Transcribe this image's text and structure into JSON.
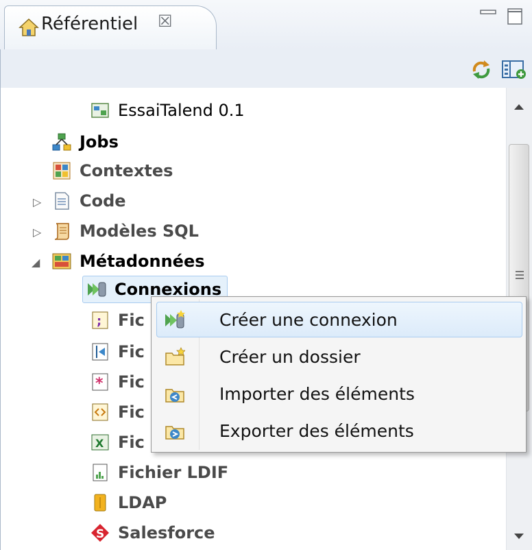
{
  "view": {
    "tab_title": "Référentiel",
    "close_symbol": "☒"
  },
  "tree": {
    "items": [
      {
        "label": "EssaiTalend 0.1",
        "icon": "project-icon",
        "color": "#1a1a1a"
      },
      {
        "label": "Jobs",
        "icon": "jobs-icon",
        "color": "#000000"
      },
      {
        "label": "Contextes",
        "icon": "contexts-icon",
        "color": "#4a4a4a"
      },
      {
        "label": "Code",
        "icon": "code-icon",
        "color": "#4a4a4a"
      },
      {
        "label": "Modèles SQL",
        "icon": "sql-templates-icon",
        "color": "#4a4a4a"
      },
      {
        "label": "Métadonnées",
        "icon": "metadata-icon",
        "color": "#000000"
      },
      {
        "label": "Connexions",
        "icon": "connections-icon",
        "color": "#000000"
      },
      {
        "label": "Fic",
        "icon": "delimited-file-icon",
        "color": "#4a4a4a"
      },
      {
        "label": "Fic",
        "icon": "positional-file-icon",
        "color": "#4a4a4a"
      },
      {
        "label": "Fic",
        "icon": "regex-file-icon",
        "color": "#4a4a4a"
      },
      {
        "label": "Fic",
        "icon": "xml-file-icon",
        "color": "#4a4a4a"
      },
      {
        "label": "Fic",
        "icon": "excel-file-icon",
        "color": "#4a4a4a"
      },
      {
        "label": "Fichier LDIF",
        "icon": "ldif-file-icon",
        "color": "#4a4a4a"
      },
      {
        "label": "LDAP",
        "icon": "ldap-icon",
        "color": "#4a4a4a"
      },
      {
        "label": "Salesforce",
        "icon": "salesforce-icon",
        "color": "#4a4a4a"
      }
    ]
  },
  "context_menu": {
    "items": [
      {
        "label": "Créer une connexion",
        "icon": "create-connection-icon"
      },
      {
        "label": "Créer un dossier",
        "icon": "create-folder-icon"
      },
      {
        "label": "Importer des éléments",
        "icon": "import-items-icon"
      },
      {
        "label": "Exporter des éléments",
        "icon": "export-items-icon"
      }
    ]
  },
  "colors": {
    "selection_bg": "#e5f1fb",
    "selection_border": "#a8cbef",
    "frame_border": "#a9b8c9"
  }
}
